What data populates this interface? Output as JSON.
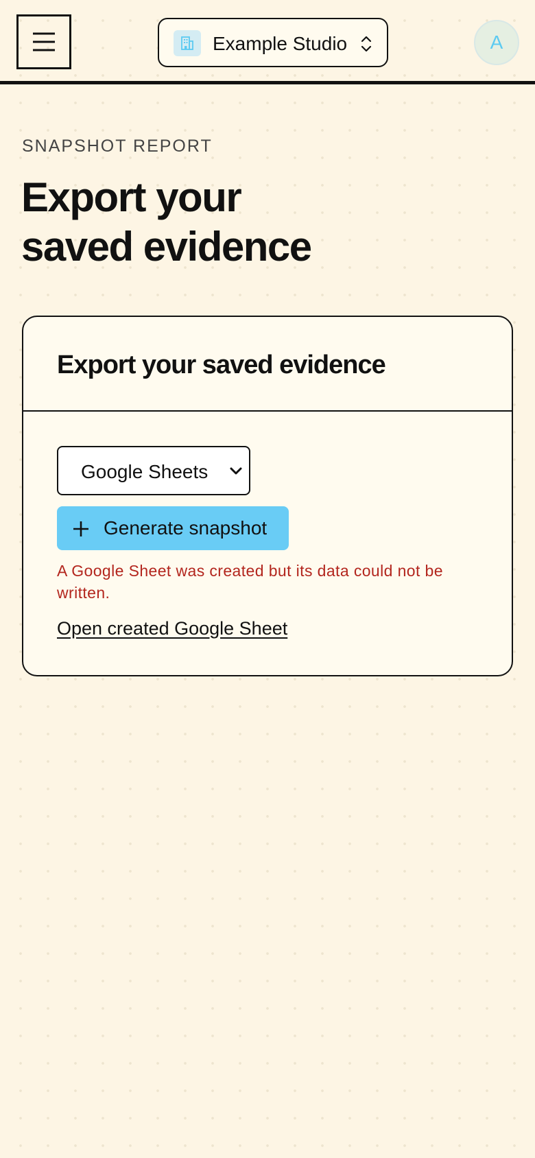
{
  "header": {
    "workspace_name": "Example Studio",
    "avatar_initial": "A"
  },
  "page": {
    "eyebrow": "SNAPSHOT REPORT",
    "title_line1": "Export your",
    "title_line2": "saved evidence"
  },
  "card": {
    "title": "Export your saved evidence",
    "export_format": "Google Sheets",
    "generate_label": "Generate snapshot",
    "error_message": "A Google Sheet was created but its data could not be written.",
    "link_label": "Open created Google Sheet"
  },
  "colors": {
    "background": "#fdf5e4",
    "primary_button": "#69ccf5",
    "error": "#b3261e",
    "avatar_text": "#5ccaf1"
  },
  "icons": {
    "menu": "hamburger-menu-icon",
    "workspace": "building-icon",
    "switch": "chevron-up-down-icon",
    "plus": "plus-icon",
    "select": "chevron-down-icon"
  }
}
